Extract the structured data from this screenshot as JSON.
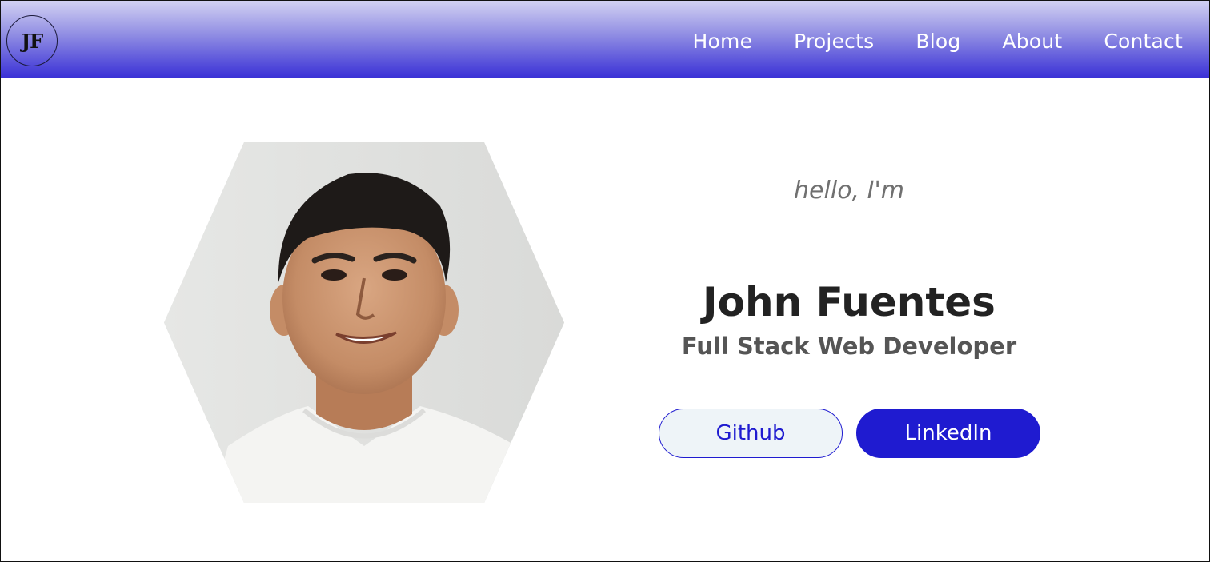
{
  "header": {
    "logo_text": "JF",
    "nav": [
      {
        "label": "Home"
      },
      {
        "label": "Projects"
      },
      {
        "label": "Blog"
      },
      {
        "label": "About"
      },
      {
        "label": "Contact"
      }
    ],
    "gradient_colors": [
      "#d2d1f2",
      "#8f8ce3",
      "#3a31d6"
    ]
  },
  "hero": {
    "greeting": "hello, I'm",
    "name": "John Fuentes",
    "title": "Full Stack Web Developer",
    "buttons": {
      "github": "Github",
      "linkedin": "LinkedIn"
    },
    "photo_icon": "portrait-photo"
  },
  "colors": {
    "accent": "#1f1bd0",
    "text_dark": "#222222",
    "text_muted": "#707070"
  }
}
